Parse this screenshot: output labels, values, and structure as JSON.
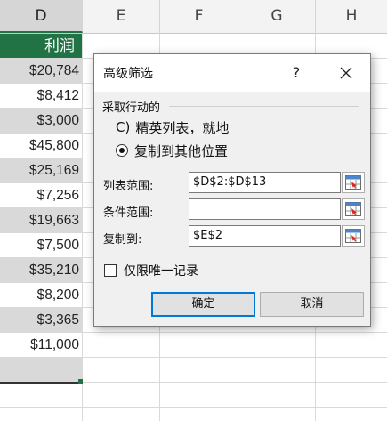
{
  "columns": [
    "D",
    "E",
    "F",
    "G",
    "H"
  ],
  "column_d": {
    "header": "利润",
    "values": [
      "$20,784",
      "$8,412",
      "$3,000",
      "$45,800",
      "$25,169",
      "$7,256",
      "$19,663",
      "$7,500",
      "$35,210",
      "$8,200",
      "$3,365",
      "$11,000"
    ]
  },
  "dialog": {
    "title": "高级筛选",
    "help": "?",
    "action_label": "采取行动的",
    "radio_in_place": "精英列表，就地",
    "radio_copy": "复制到其他位置",
    "radio_in_place_accel": "C)",
    "list_range_label": "列表范围:",
    "list_range_value": "$D$2:$D$13",
    "criteria_range_label": "条件范围:",
    "criteria_range_value": "",
    "copy_to_label": "复制到:",
    "copy_to_value": "$E$2",
    "unique_label": "仅限唯一记录",
    "ok_label": "确定",
    "cancel_label": "取消"
  },
  "colors": {
    "accent": "#217346",
    "focus": "#0078d7"
  }
}
